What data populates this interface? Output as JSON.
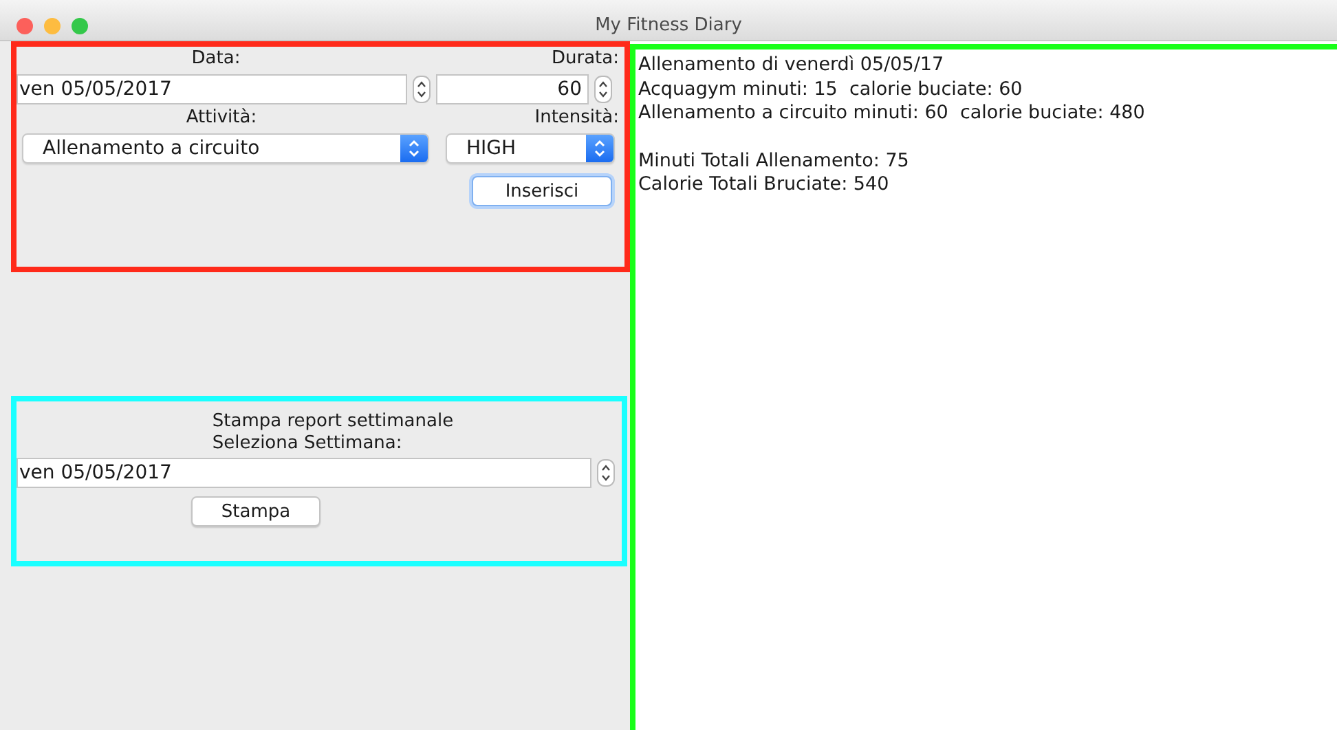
{
  "window": {
    "title": "My Fitness Diary"
  },
  "entry_form": {
    "date_label": "Data:",
    "date_value": "ven 05/05/2017",
    "duration_label": "Durata:",
    "duration_value": "60",
    "activity_label": "Attività:",
    "activity_value": "Allenamento a circuito",
    "intensity_label": "Intensità:",
    "intensity_value": "HIGH",
    "insert_button": "Inserisci"
  },
  "report_form": {
    "title": "Stampa report settimanale",
    "week_label": "Seleziona Settimana:",
    "week_value": "ven 05/05/2017",
    "print_button": "Stampa"
  },
  "report": {
    "entries": [
      "Allenamento di venerdì 05/05/17",
      "Acquagym minuti: 15  calorie buciate: 60",
      "Allenamento a circuito minuti: 60  calorie buciate: 480"
    ],
    "totals": [
      "Minuti Totali Allenamento: 75",
      "Calorie Totali Bruciate: 540"
    ]
  }
}
